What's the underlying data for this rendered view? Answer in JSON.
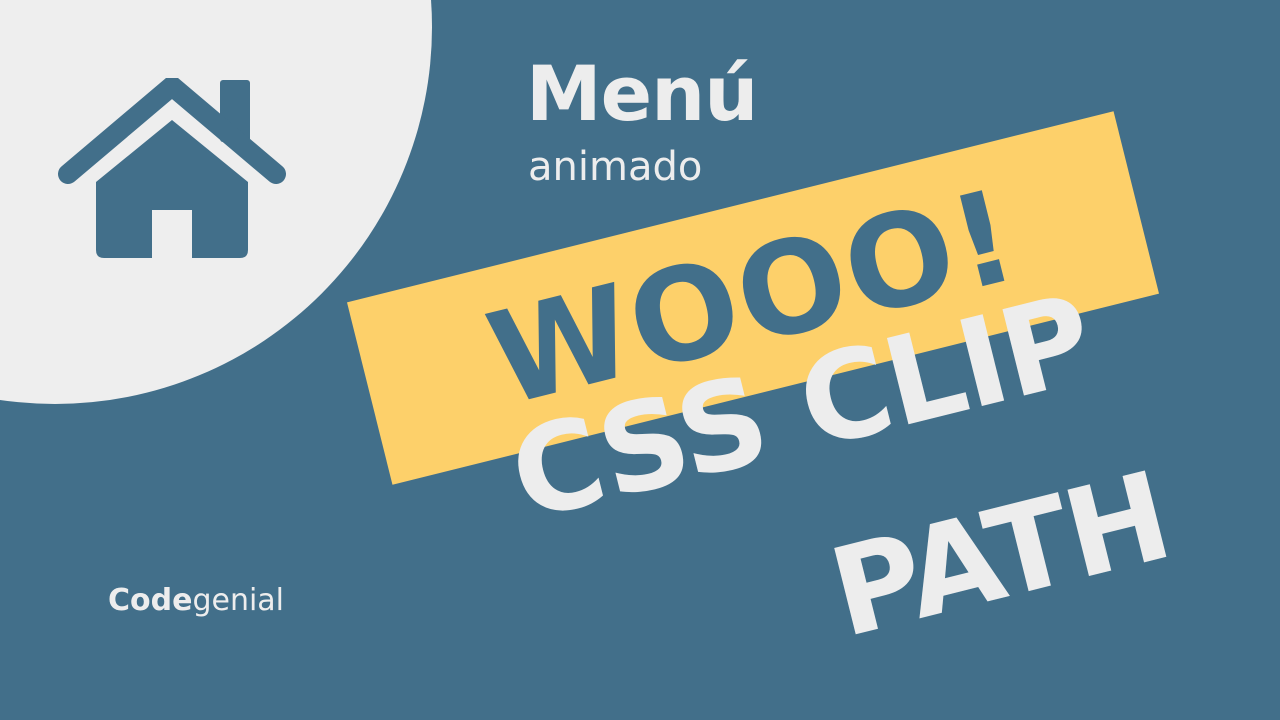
{
  "colors": {
    "background": "#426f8a",
    "circle": "#eeeeee",
    "banner": "#fdd06a",
    "text_light": "#ededed",
    "text_dark": "#426f8a"
  },
  "icons": {
    "home": "home-icon"
  },
  "title": {
    "main": "Menú",
    "sub": "animado"
  },
  "banner": {
    "text": "WOOO!"
  },
  "headline": {
    "line1": "CSS CLIP",
    "line2": "PATH"
  },
  "brand": {
    "bold": "Code",
    "light": "genial"
  }
}
